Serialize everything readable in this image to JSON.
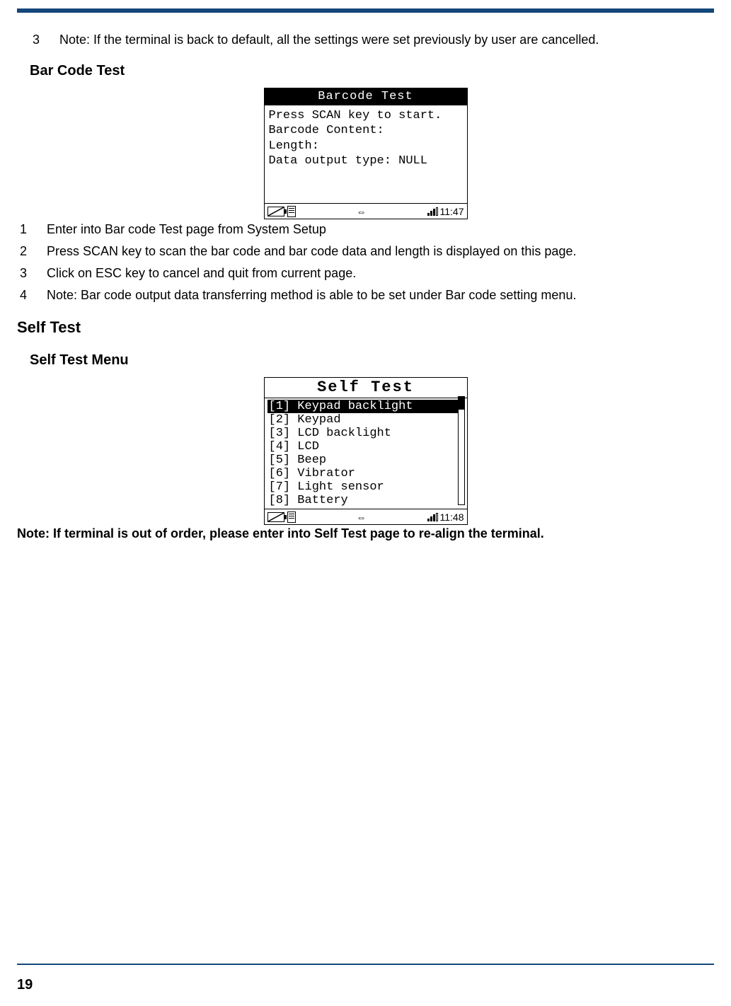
{
  "page_number": "19",
  "intro_list": {
    "items": [
      {
        "n": "3",
        "text": "Note: If the terminal is back to default, all the settings were set previously by user are cancelled."
      }
    ]
  },
  "barcode_section": {
    "heading": "Bar Code Test",
    "screen": {
      "title": "Barcode Test",
      "lines": [
        "Press SCAN key to start.",
        "Barcode Content:",
        "",
        "Length:",
        "Data output type: NULL"
      ],
      "status": {
        "usb": "⇔",
        "time": "11:47"
      }
    },
    "steps": [
      {
        "n": "1",
        "text": "Enter into Bar code Test page from System Setup"
      },
      {
        "n": "2",
        "text": "Press SCAN key to scan the bar code and bar code data and length is displayed on this page."
      },
      {
        "n": "3",
        "text": "Click on ESC key to cancel and quit from current page."
      },
      {
        "n": "4",
        "text": "Note: Bar code output data transferring method is able to be set under Bar code setting menu."
      }
    ]
  },
  "selftest_section": {
    "heading_main": "Self Test",
    "heading_sub": "Self Test Menu",
    "screen": {
      "title": "Self Test",
      "items": [
        "[1] Keypad backlight",
        "[2] Keypad",
        "[3] LCD backlight",
        "[4] LCD",
        "[5] Beep",
        "[6] Vibrator",
        "[7] Light sensor",
        "[8] Battery"
      ],
      "selected_index": 0,
      "status": {
        "usb": "⇔",
        "time": "11:48"
      }
    },
    "note": "Note: If terminal is out of order, please enter into Self Test page to re-align the terminal."
  }
}
